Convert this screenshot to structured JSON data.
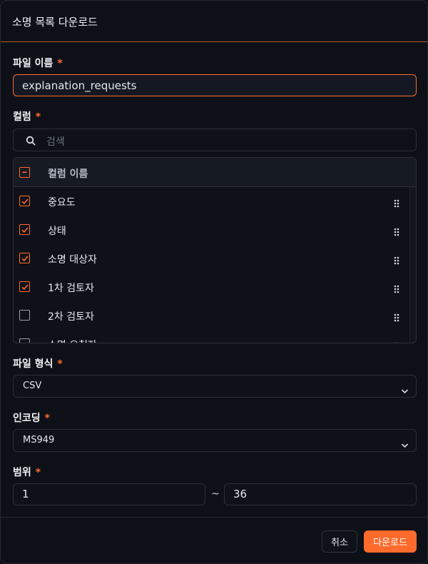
{
  "dialog": {
    "title": "소명 목록 다운로드"
  },
  "file_name": {
    "label": "파일 이름",
    "required": "*",
    "value": "explanation_requests"
  },
  "columns": {
    "label": "컬럼",
    "required": "*",
    "search_placeholder": "검색",
    "header_label": "컬럼 이름",
    "items": [
      {
        "label": "중요도",
        "checked": true
      },
      {
        "label": "상태",
        "checked": true
      },
      {
        "label": "소명 대상자",
        "checked": true
      },
      {
        "label": "1차 검토자",
        "checked": true
      },
      {
        "label": "2차 검토자",
        "checked": false
      },
      {
        "label": "소명 요청자",
        "checked": false
      }
    ]
  },
  "file_format": {
    "label": "파일 형식",
    "required": "*",
    "value": "CSV"
  },
  "encoding": {
    "label": "인코딩",
    "required": "*",
    "value": "MS949"
  },
  "range": {
    "label": "범위",
    "required": "*",
    "from": "1",
    "separator": "~",
    "to": "36"
  },
  "footer": {
    "cancel_label": "취소",
    "download_label": "다운로드"
  },
  "colors": {
    "accent": "#ff6b2c",
    "background": "#0d1017",
    "border": "#2a2f3a"
  }
}
